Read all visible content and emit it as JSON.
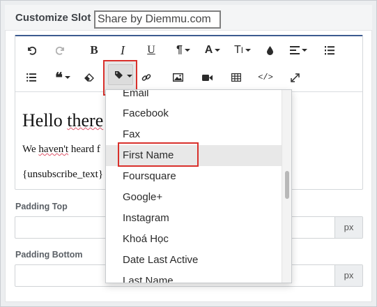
{
  "header": {
    "title": "Customize Slot",
    "watermark": "Share by Diemmu.com"
  },
  "editor": {
    "content": {
      "heading_start": "Hello ",
      "heading_squig": "there",
      "paragraph_start": "We ",
      "paragraph_squig": "haven't",
      "paragraph_end": " heard f",
      "token": "{unsubscribe_text}"
    },
    "toolbar_icons": [
      "undo-icon",
      "redo-icon",
      "bold-icon",
      "italic-icon",
      "underline-icon",
      "paragraph-icon",
      "font-color-icon",
      "font-size-icon",
      "ink-icon",
      "align-icon",
      "ordered-list-icon",
      "unordered-list-icon",
      "quote-icon",
      "eraser-icon",
      "tag-icon",
      "link-icon",
      "image-icon",
      "video-icon",
      "table-icon",
      "code-view-icon",
      "fullscreen-icon"
    ]
  },
  "fields": {
    "padding_top": {
      "label": "Padding Top",
      "value": "",
      "unit": "px"
    },
    "padding_bottom": {
      "label": "Padding Bottom",
      "value": "",
      "unit": "px"
    }
  },
  "dropdown": {
    "items": [
      "Email",
      "Facebook",
      "Fax",
      "First Name",
      "Foursquare",
      "Google+",
      "Instagram",
      "Khoá Học",
      "Date Last Active",
      "Last Name"
    ],
    "highlighted": "First Name"
  },
  "colors": {
    "accent": "#3c5a8f",
    "highlight": "#d9302b"
  }
}
